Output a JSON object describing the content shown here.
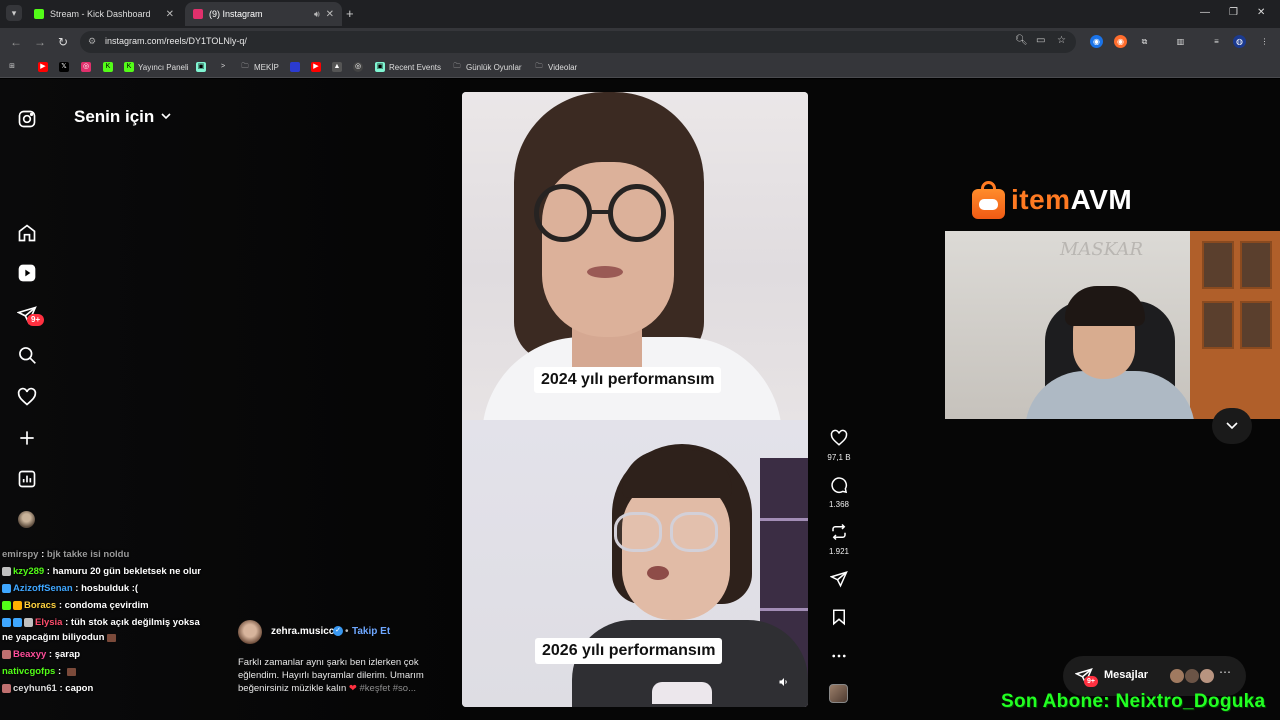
{
  "browser": {
    "tabs": [
      {
        "title": "Stream - Kick Dashboard",
        "favicon_color": "#53fc18",
        "favicon_icon": "kick-icon"
      },
      {
        "title": "(9) Instagram",
        "favicon_color": "#e1306c",
        "favicon_icon": "instagram-icon",
        "active": true
      }
    ],
    "url": "instagram.com/reels/DY1TOLNly-q/",
    "bookmarks": [
      {
        "label": "",
        "icon": "youtube-icon",
        "color": "#ff0000"
      },
      {
        "label": "",
        "icon": "x-icon",
        "color": "#000000"
      },
      {
        "label": "",
        "icon": "instagram-icon",
        "color": "#e1306c"
      },
      {
        "label": "",
        "icon": "kick-icon",
        "color": "#53fc18"
      },
      {
        "label": "Yayıncı Paneli",
        "icon": "kick-icon",
        "color": "#53fc18"
      },
      {
        "label": "",
        "icon": "streamlabs-icon",
        "color": "#80f5d2"
      },
      {
        "label": "",
        "icon": "prompt-icon",
        "color": "#35363a"
      },
      {
        "label": "MEKİP",
        "icon": "folder-icon",
        "color": "#35363a"
      },
      {
        "label": "",
        "icon": "site-icon",
        "color": "#2b3bd1"
      },
      {
        "label": "",
        "icon": "youtube-icon",
        "color": "#ff0000"
      },
      {
        "label": "",
        "icon": "image-icon",
        "color": "#555555"
      },
      {
        "label": "",
        "icon": "circle-icon",
        "color": "#444444"
      },
      {
        "label": "Recent Events",
        "icon": "streamlabs-icon",
        "color": "#80f5d2"
      },
      {
        "label": "Günlük Oyunlar",
        "icon": "folder-icon",
        "color": "#35363a"
      },
      {
        "label": "Videolar",
        "icon": "folder-icon",
        "color": "#35363a"
      }
    ]
  },
  "instagram": {
    "feed_title": "Senin için",
    "nav_badge": "9+",
    "reel": {
      "caption_top": "2024 yılı performansım",
      "caption_bottom": "2026 yılı performansım",
      "likes": "97,1 B",
      "comments": "1.368",
      "reposts": "1.921"
    },
    "author": {
      "name": "zehra.musicc",
      "follow": "Takip Et",
      "separator": "•"
    },
    "description": {
      "text": "Farklı zamanlar aynı şarkı ben izlerken çok eğlendim. Hayırlı bayramlar dilerim. Umarım beğenirsiniz müzikle kalın",
      "tags": "#keşfet #so..."
    },
    "messages": {
      "label": "Mesajlar",
      "badge": "9+"
    }
  },
  "stream_overlay": {
    "chat": [
      {
        "user": "emirspy",
        "msg": "bjk takke isi noldu",
        "color": "#9a9a9a",
        "dim": true,
        "badges": []
      },
      {
        "user": "kzy289",
        "msg": "hamuru 20 gün bekletsek ne olur",
        "color": "#53fc18",
        "badges": [
          "#c0c0c0"
        ]
      },
      {
        "user": "AzizoffSenan",
        "msg": "hosbulduk :(",
        "color": "#3fa7ff",
        "badges": [
          "#3fa7ff"
        ]
      },
      {
        "user": "Boracs",
        "msg": "condoma çevirdim",
        "color": "#ffd23f",
        "badges": [
          "#53fc18",
          "#ffb000"
        ]
      },
      {
        "user": "Elysia",
        "msg": "tüh stok açık değilmiş yoksa",
        "color": "#ff4d6d",
        "badges": [
          "#3fa7ff",
          "#3fa7ff",
          "#c0c0c0"
        ]
      },
      {
        "user": "",
        "msg": "ne yapcağını biliyodun",
        "color": "#ffffff",
        "badges": [],
        "continuation": true
      },
      {
        "user": "Beaxyy",
        "msg": "şarap",
        "color": "#ff4d9a",
        "badges": [
          "#c07070"
        ]
      },
      {
        "user": "nativcgofps",
        "msg": "",
        "color": "#53fc18",
        "badges": [],
        "emote": true
      },
      {
        "user": "ceyhun61",
        "msg": "capon",
        "color": "#dddddd",
        "badges": [
          "#c07070"
        ]
      }
    ],
    "sponsor": {
      "brand_a": "item",
      "brand_b": "AVM"
    },
    "webcam_sign": "MASKAR",
    "last_sub": "Son Abone: Neixtro_Doguka"
  }
}
